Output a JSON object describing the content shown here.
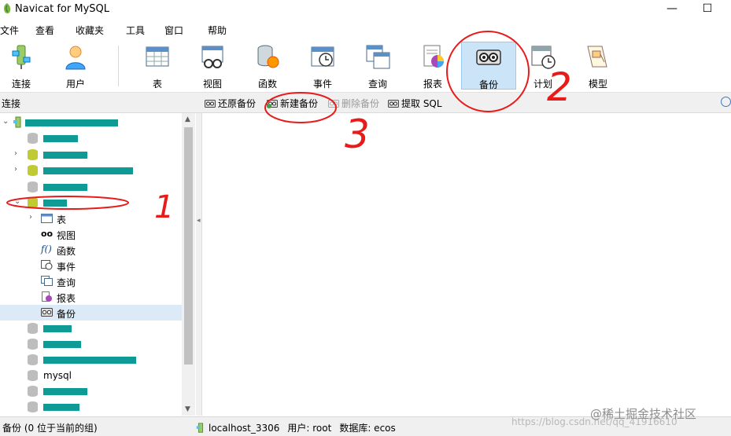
{
  "window": {
    "title": "Navicat for MySQL",
    "minimize": "—",
    "maximize": "☐"
  },
  "menu": [
    "文件",
    "查看",
    "收藏夹",
    "工具",
    "窗口",
    "帮助"
  ],
  "toolbar": {
    "buttons": [
      {
        "label": "连接",
        "icon": "connection-icon"
      },
      {
        "label": "用户",
        "icon": "user-icon"
      },
      {
        "label": "表",
        "icon": "table-icon"
      },
      {
        "label": "视图",
        "icon": "view-icon"
      },
      {
        "label": "函数",
        "icon": "function-icon"
      },
      {
        "label": "事件",
        "icon": "event-icon"
      },
      {
        "label": "查询",
        "icon": "query-icon"
      },
      {
        "label": "报表",
        "icon": "report-icon"
      },
      {
        "label": "备份",
        "icon": "backup-icon",
        "active": true
      },
      {
        "label": "计划",
        "icon": "schedule-icon"
      },
      {
        "label": "模型",
        "icon": "model-icon"
      }
    ]
  },
  "subtoolbar": {
    "connection_label": "连接",
    "restore": "还原备份",
    "new_backup": "新建备份",
    "delete_backup": "删除备份",
    "extract_sql": "提取 SQL"
  },
  "tree": {
    "children": [
      {
        "label": "表",
        "icon": "table-icon"
      },
      {
        "label": "视图",
        "icon": "view-icon"
      },
      {
        "label": "函数",
        "icon": "function-icon"
      },
      {
        "label": "事件",
        "icon": "event-icon"
      },
      {
        "label": "查询",
        "icon": "query-icon"
      },
      {
        "label": "报表",
        "icon": "report-icon"
      },
      {
        "label": "备份",
        "icon": "backup-icon"
      }
    ],
    "mysql_db": "mysql"
  },
  "status": {
    "left": "备份 (0 位于当前的组)",
    "connection": "localhost_3306",
    "user": "用户: root",
    "database": "数据库: ecos"
  },
  "watermarks": {
    "blog": "https://blog.csdn.net/qq_41916610",
    "brand": "@稀土掘金技术社区"
  },
  "annotations": [
    "1",
    "2",
    "3"
  ],
  "colors": {
    "accent": "#cce4f7",
    "redaction": "#0f9b95",
    "annotation": "#e81b1b"
  }
}
